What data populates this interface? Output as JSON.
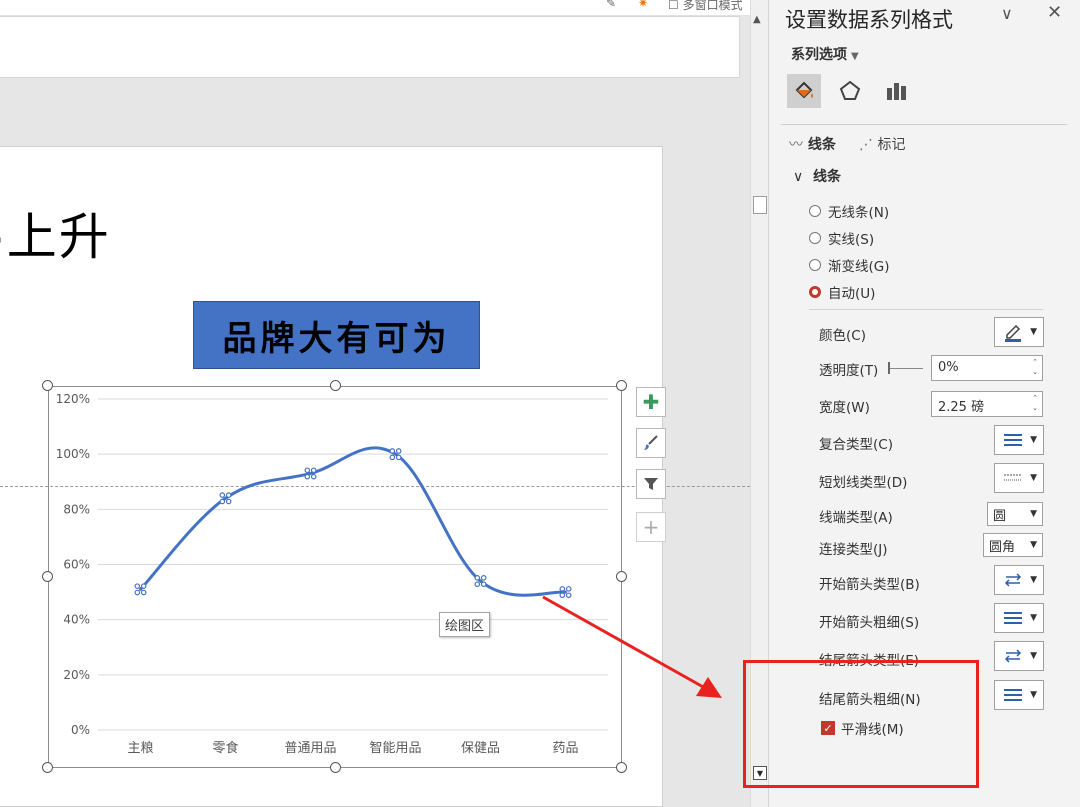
{
  "top_strip": {
    "mode_label": "多窗口模式"
  },
  "slide": {
    "title_fragment": "上升",
    "brand_text": "品牌大有可为",
    "plot_area_tooltip": "绘图区"
  },
  "chart_data": {
    "type": "line",
    "smooth": true,
    "categories": [
      "主粮",
      "零食",
      "普通用品",
      "智能用品",
      "保健品",
      "药品"
    ],
    "series": [
      {
        "values": [
          51,
          84,
          93,
          100,
          54,
          50
        ],
        "color": "#4472c4"
      }
    ],
    "ylim": [
      0,
      120
    ],
    "yticks": [
      "0%",
      "20%",
      "40%",
      "60%",
      "80%",
      "100%",
      "120%"
    ],
    "ytick_values": [
      0,
      20,
      40,
      60,
      80,
      100,
      120
    ],
    "grid": true,
    "legend": "none"
  },
  "chart_tools": {
    "add_element_icon": "plus-icon",
    "style_icon": "brush-icon",
    "filter_icon": "filter-icon",
    "extra_icon": "plus-icon"
  },
  "pane": {
    "title": "设置数据系列格式",
    "series_options": "系列选项",
    "tabs": [
      "fill-line-icon",
      "effects-icon",
      "series-options-icon"
    ],
    "subtabs": {
      "line": "线条",
      "marker": "标记"
    },
    "section": "线条",
    "line_types": [
      {
        "label": "无线条(N)",
        "selected": false
      },
      {
        "label": "实线(S)",
        "selected": false
      },
      {
        "label": "渐变线(G)",
        "selected": false
      },
      {
        "label": "自动(U)",
        "selected": true
      }
    ],
    "props": {
      "color": "颜色(C)",
      "transparency": "透明度(T)",
      "transparency_value": "0%",
      "width": "宽度(W)",
      "width_value": "2.25 磅",
      "compound": "复合类型(C)",
      "dash": "短划线类型(D)",
      "cap": "线端类型(A)",
      "cap_value": "圆",
      "join": "连接类型(J)",
      "join_value": "圆角",
      "begin_arrow_type": "开始箭头类型(B)",
      "begin_arrow_size": "开始箭头粗细(S)",
      "end_arrow_type": "结尾箭头类型(E)",
      "end_arrow_size": "结尾箭头粗细(N)",
      "smooth": "平滑线(M)",
      "smooth_checked": true
    }
  },
  "annotation": {
    "color": "#e8231f"
  }
}
